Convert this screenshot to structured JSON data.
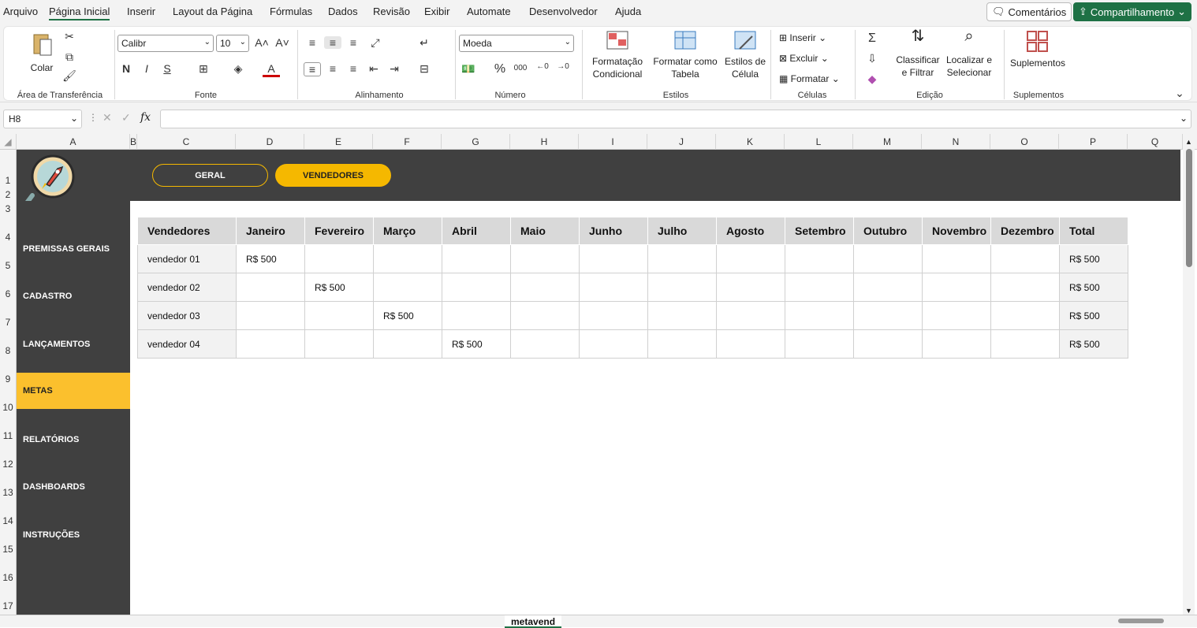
{
  "menu": [
    "Arquivo",
    "Página Inicial",
    "Inserir",
    "Layout da Página",
    "Fórmulas",
    "Dados",
    "Revisão",
    "Exibir",
    "Automate",
    "Desenvolvedor",
    "Ajuda"
  ],
  "top_buttons": {
    "comments": "Comentários",
    "share": "Compartilhamento"
  },
  "ribbon": {
    "clipboard": {
      "paste": "Colar",
      "label": "Área de Transferência"
    },
    "font": {
      "name": "Calibr",
      "size": "10",
      "label": "Fonte",
      "bold": "N",
      "italic": "I",
      "underline": "S"
    },
    "alignment": {
      "label": "Alinhamento"
    },
    "number": {
      "format": "Moeda",
      "label": "Número",
      "percent": "%",
      "thousands": "000"
    },
    "styles": {
      "cond1": "Formatação",
      "cond2": "Condicional",
      "table1": "Formatar como",
      "table2": "Tabela",
      "cell1": "Estilos de",
      "cell2": "Célula",
      "label": "Estilos"
    },
    "cells": {
      "insert": "Inserir",
      "delete": "Excluir",
      "format": "Formatar",
      "label": "Células"
    },
    "editing": {
      "sort1": "Classificar",
      "sort2": "e Filtrar",
      "find1": "Localizar e",
      "find2": "Selecionar",
      "label": "Edição"
    },
    "addins": {
      "btn": "Suplementos",
      "label": "Suplementos"
    }
  },
  "formula_bar": {
    "cell_ref": "H8",
    "fx": "fx"
  },
  "columns": [
    "A",
    "B",
    "C",
    "D",
    "E",
    "F",
    "G",
    "H",
    "I",
    "J",
    "K",
    "L",
    "M",
    "N",
    "O",
    "P",
    "Q"
  ],
  "rows": [
    "1",
    "2",
    "3",
    "4",
    "5",
    "6",
    "7",
    "8",
    "9",
    "10",
    "11",
    "12",
    "13",
    "14",
    "15",
    "16",
    "17"
  ],
  "nav_pills": {
    "geral": "GERAL",
    "vendedores": "VENDEDORES"
  },
  "sidebar": [
    "PREMISSAS GERAIS",
    "CADASTRO",
    "LANÇAMENTOS",
    "METAS",
    "RELATÓRIOS",
    "DASHBOARDS",
    "INSTRUÇÕES"
  ],
  "table": {
    "headers": [
      "Vendedores",
      "Janeiro",
      "Fevereiro",
      "Março",
      "Abril",
      "Maio",
      "Junho",
      "Julho",
      "Agosto",
      "Setembro",
      "Outubro",
      "Novembro",
      "Dezembro",
      "Total"
    ],
    "rows": [
      [
        "vendedor 01",
        "R$ 500",
        "",
        "",
        "",
        "",
        "",
        "",
        "",
        "",
        "",
        "",
        "",
        "R$ 500"
      ],
      [
        "vendedor 02",
        "",
        "R$ 500",
        "",
        "",
        "",
        "",
        "",
        "",
        "",
        "",
        "",
        "",
        "R$ 500"
      ],
      [
        "vendedor 03",
        "",
        "",
        "R$ 500",
        "",
        "",
        "",
        "",
        "",
        "",
        "",
        "",
        "",
        "R$ 500"
      ],
      [
        "vendedor 04",
        "",
        "",
        "",
        "R$ 500",
        "",
        "",
        "",
        "",
        "",
        "",
        "",
        "",
        "R$ 500"
      ]
    ]
  },
  "sheet_tabs": {
    "active": "metavend"
  },
  "colors": {
    "dark": "#404040",
    "accent": "#fbc02d",
    "excel_green": "#1e7145"
  }
}
